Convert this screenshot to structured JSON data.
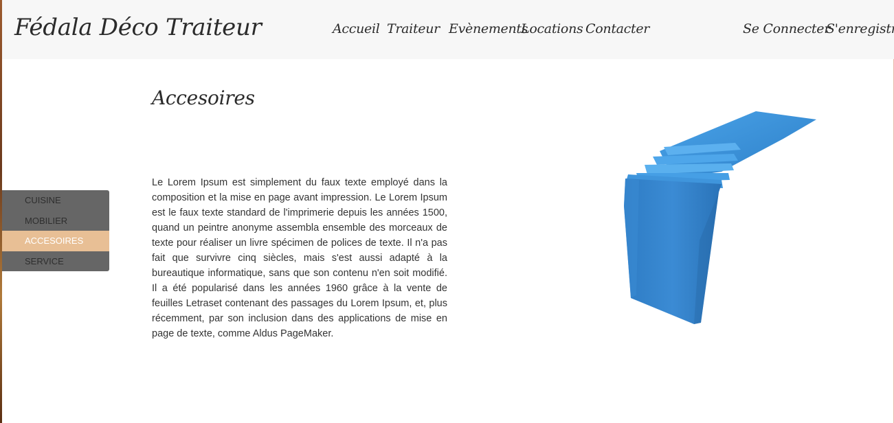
{
  "header": {
    "brand": "Fédala Déco Traiteur",
    "nav": [
      "Accueil",
      "Traiteur",
      "Evènements",
      "Locations",
      "Contacter"
    ],
    "auth": {
      "login": "Se Connecter",
      "register": "S'enregistrer"
    }
  },
  "page": {
    "title": "Accesoires",
    "body": "Le Lorem Ipsum est simplement du faux texte employé dans la composition et la mise en page avant impression. Le Lorem Ipsum est le faux texte standard de l'imprimerie depuis les années 1500, quand un peintre anonyme assembla ensemble des morceaux de texte pour réaliser un livre spécimen de polices de texte. Il n'a pas fait que survivre cinq siècles, mais s'est aussi adapté à la bureautique informatique, sans que son contenu n'en soit modifié. Il a été popularisé dans les années 1960 grâce à la vente de feuilles Letraset contenant des passages du Lorem Ipsum, et, plus récemment, par son inclusion dans des applications de mise en page de texte, comme Aldus PageMaker."
  },
  "sidemenu": {
    "items": [
      "CUISINE",
      "MOBILIER",
      "ACCESOIRES",
      "SERVICE"
    ],
    "active": "ACCESOIRES"
  },
  "colors": {
    "header_bg": "#f7f7f7",
    "menu_bg": "#666666",
    "menu_active": "#e8bf95",
    "product_blue": "#3d8fd6"
  },
  "images": {
    "product": "blue-satin-table-runner"
  }
}
